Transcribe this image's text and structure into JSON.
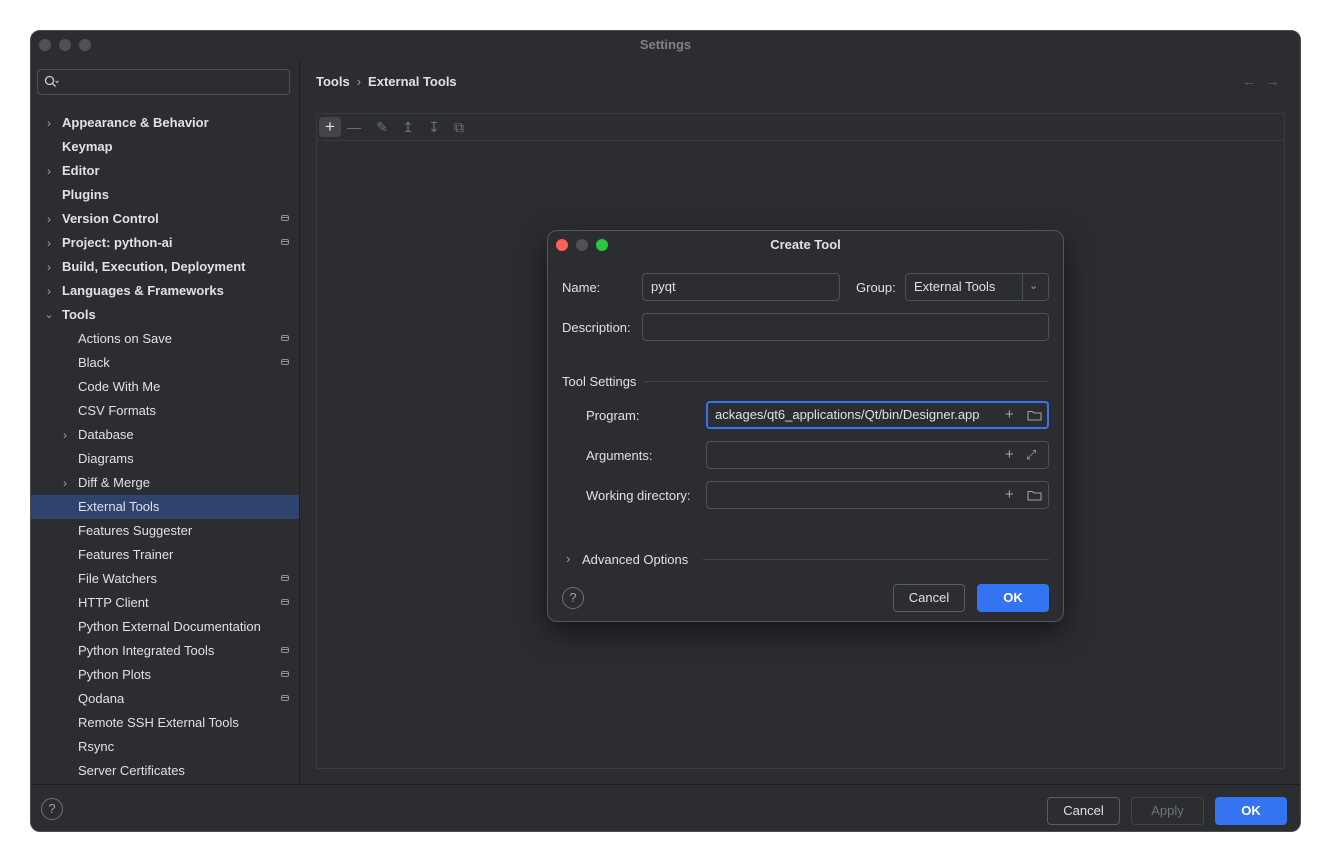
{
  "window": {
    "title": "Settings"
  },
  "search": {
    "placeholder": ""
  },
  "breadcrumb": {
    "parent": "Tools",
    "current": "External Tools"
  },
  "tree": {
    "appearance": "Appearance & Behavior",
    "keymap": "Keymap",
    "editor": "Editor",
    "plugins": "Plugins",
    "vcs": "Version Control",
    "project": "Project: python-ai",
    "build": "Build, Execution, Deployment",
    "languages": "Languages & Frameworks",
    "tools": "Tools",
    "actions_on_save": "Actions on Save",
    "black": "Black",
    "code_with_me": "Code With Me",
    "csv_formats": "CSV Formats",
    "database": "Database",
    "diagrams": "Diagrams",
    "diff_merge": "Diff & Merge",
    "external_tools": "External Tools",
    "features_suggester": "Features Suggester",
    "features_trainer": "Features Trainer",
    "file_watchers": "File Watchers",
    "http_client": "HTTP Client",
    "python_ext_doc": "Python External Documentation",
    "python_integrated": "Python Integrated Tools",
    "python_plots": "Python Plots",
    "qodana": "Qodana",
    "remote_ssh": "Remote SSH External Tools",
    "rsync": "Rsync",
    "server_certs": "Server Certificates"
  },
  "footer": {
    "cancel": "Cancel",
    "apply": "Apply",
    "ok": "OK",
    "help": "?"
  },
  "dialog": {
    "title": "Create Tool",
    "name_label": "Name:",
    "name_value": "pyqt",
    "group_label": "Group:",
    "group_value": "External Tools",
    "description_label": "Description:",
    "description_value": "",
    "section_tool_settings": "Tool Settings",
    "program_label": "Program:",
    "program_value": "ackages/qt6_applications/Qt/bin/Designer.app",
    "arguments_label": "Arguments:",
    "arguments_value": "",
    "workdir_label": "Working directory:",
    "workdir_value": "",
    "advanced_label": "Advanced Options",
    "cancel": "Cancel",
    "ok": "OK",
    "help": "?"
  },
  "colors": {
    "accent": "#3574f0",
    "background": "#2b2d30",
    "selection": "#2e436e",
    "close": "#ff5f57",
    "minimize": "#febc2e",
    "zoom": "#28c840"
  },
  "icons": [
    "search-icon",
    "chevron-right-icon",
    "chevron-down-icon",
    "project-scope-icon",
    "add-icon",
    "remove-icon",
    "edit-icon",
    "move-up-icon",
    "move-down-icon",
    "copy-icon",
    "back-arrow-icon",
    "forward-arrow-icon",
    "help-icon",
    "folder-icon",
    "expand-icon",
    "dropdown-arrow-icon"
  ]
}
